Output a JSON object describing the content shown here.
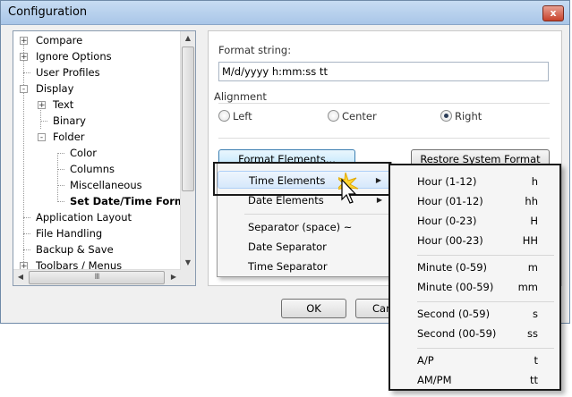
{
  "window": {
    "title": "Configuration",
    "close_label": "x"
  },
  "tree": {
    "items": [
      {
        "label": "Compare",
        "expander": "+"
      },
      {
        "label": "Ignore Options",
        "expander": "+"
      },
      {
        "label": "User Profiles",
        "expander": ""
      },
      {
        "label": "Display",
        "expander": "-"
      },
      {
        "label": "Text",
        "expander": "+"
      },
      {
        "label": "Binary",
        "expander": ""
      },
      {
        "label": "Folder",
        "expander": "-"
      },
      {
        "label": "Color",
        "expander": ""
      },
      {
        "label": "Columns",
        "expander": ""
      },
      {
        "label": "Miscellaneous",
        "expander": ""
      },
      {
        "label": "Set Date/Time Format",
        "expander": "",
        "selected": true
      },
      {
        "label": "Application Layout",
        "expander": ""
      },
      {
        "label": "File Handling",
        "expander": ""
      },
      {
        "label": "Backup & Save",
        "expander": ""
      },
      {
        "label": "Toolbars / Menus",
        "expander": "+"
      }
    ],
    "hscroll_grip": "III"
  },
  "format": {
    "label": "Format string:",
    "value": "M/d/yyyy h:mm:ss tt"
  },
  "alignment": {
    "label": "Alignment",
    "options": [
      {
        "label": "Left",
        "checked": false
      },
      {
        "label": "Center",
        "checked": false
      },
      {
        "label": "Right",
        "checked": true
      }
    ]
  },
  "buttons": {
    "format_elements": "Format Elements...",
    "restore": "Restore System Format",
    "ok": "OK",
    "cancel": "Can"
  },
  "menu": {
    "items": [
      {
        "label": "Time Elements",
        "submenu": true
      },
      {
        "label": "Date Elements",
        "submenu": true
      },
      {
        "label": "Separator (space)  ~",
        "submenu": false
      },
      {
        "label": "Date Separator",
        "submenu": false
      },
      {
        "label": "Time Separator",
        "submenu": false
      }
    ]
  },
  "submenu": {
    "groups": [
      [
        {
          "label": "Hour (1-12)",
          "code": "h"
        },
        {
          "label": "Hour (01-12)",
          "code": "hh"
        },
        {
          "label": "Hour (0-23)",
          "code": "H"
        },
        {
          "label": "Hour (00-23)",
          "code": "HH"
        }
      ],
      [
        {
          "label": "Minute (0-59)",
          "code": "m"
        },
        {
          "label": "Minute (00-59)",
          "code": "mm"
        }
      ],
      [
        {
          "label": "Second (0-59)",
          "code": "s"
        },
        {
          "label": "Second (00-59)",
          "code": "ss"
        }
      ],
      [
        {
          "label": "A/P",
          "code": "t"
        },
        {
          "label": "AM/PM",
          "code": "tt"
        }
      ]
    ]
  },
  "colors": {
    "highlight": "#d6e8fb",
    "callout_border": "#1a1a1a",
    "title_bar": "#b5cfee"
  }
}
